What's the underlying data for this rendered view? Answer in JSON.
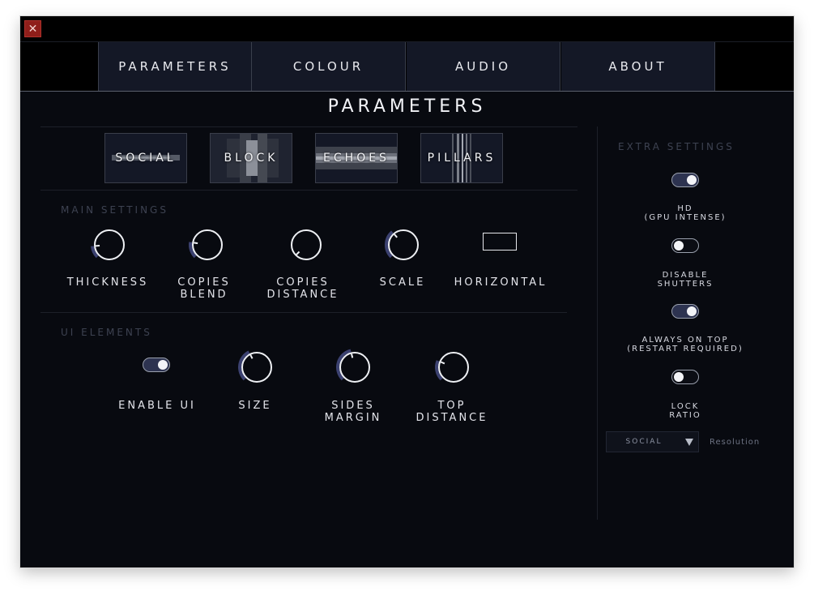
{
  "window": {
    "close_glyph": "✕"
  },
  "nav": {
    "tabs": [
      "PARAMETERS",
      "COLOUR",
      "AUDIO",
      "ABOUT"
    ]
  },
  "page_title": "PARAMETERS",
  "presets": [
    "SOCIAL",
    "BLOCK",
    "ECHOES",
    "PILLARS"
  ],
  "main_settings": {
    "label": "MAIN SETTINGS",
    "controls": [
      {
        "label": "THICKNESS",
        "value": 0.15
      },
      {
        "label": "COPIES\nBLEND",
        "value": 0.2
      },
      {
        "label": "COPIES\nDISTANCE",
        "value": 0.0
      },
      {
        "label": "SCALE",
        "value": 0.35
      },
      {
        "label": "HORIZONTAL"
      }
    ]
  },
  "ui_elements": {
    "label": "UI ELEMENTS",
    "enable_ui": {
      "label": "ENABLE UI",
      "on": true
    },
    "controls": [
      {
        "label": "SIZE",
        "value": 0.4
      },
      {
        "label": "SIDES\nMARGIN",
        "value": 0.45
      },
      {
        "label": "TOP\nDISTANCE",
        "value": 0.25
      }
    ]
  },
  "extra_settings": {
    "title": "EXTRA SETTINGS",
    "toggles": [
      {
        "label": "HD\n(GPU INTENSE)",
        "on": true
      },
      {
        "label": "DISABLE\nSHUTTERS",
        "on": false
      },
      {
        "label": "ALWAYS ON TOP\n(RESTART REQUIRED)",
        "on": true
      },
      {
        "label": "LOCK\nRATIO",
        "on": false
      }
    ],
    "resolution": {
      "value": "SOCIAL",
      "label": "Resolution"
    }
  },
  "colors": {
    "accent": "#2d3350",
    "knob_arc": "#3b4170",
    "close": "#8e1e1a",
    "background": "#080a10"
  }
}
